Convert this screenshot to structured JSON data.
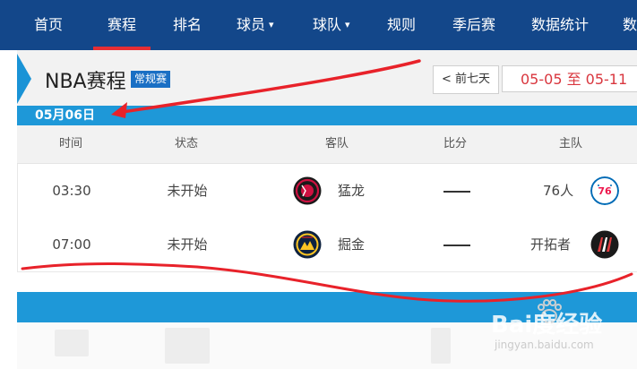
{
  "nav": {
    "items": [
      {
        "label": "首页"
      },
      {
        "label": "赛程"
      },
      {
        "label": "排名"
      },
      {
        "label": "球员",
        "chevron": "▾"
      },
      {
        "label": "球队",
        "chevron": "▾"
      },
      {
        "label": "规则"
      },
      {
        "label": "季后赛"
      },
      {
        "label": "数据统计"
      },
      {
        "label": "数"
      }
    ],
    "active": "赛程"
  },
  "header": {
    "title": "NBA赛程",
    "badge": "常规赛",
    "prev_button": "< 前七天",
    "date_range": "05-05 至 05-11"
  },
  "date_bar": {
    "date": "05月06日"
  },
  "table": {
    "columns": [
      "时间",
      "状态",
      "客队",
      "比分",
      "主队"
    ],
    "rows": [
      {
        "time": "03:30",
        "status": "未开始",
        "away": "猛龙",
        "away_logo": "raptors-logo-icon",
        "score": "",
        "home": "76人",
        "home_logo": "76ers-logo-icon"
      },
      {
        "time": "07:00",
        "status": "未开始",
        "away": "掘金",
        "away_logo": "nuggets-logo-icon",
        "score": "",
        "home": "开拓者",
        "home_logo": "trail-blazers-logo-icon"
      }
    ]
  },
  "colors": {
    "nav_bg": "#13478a",
    "accent_red": "#e62e34",
    "date_bar": "#1e98d8",
    "date_range_text": "#d9363e",
    "annotation": "#e8222a"
  },
  "watermark": {
    "main": "Bai度经验",
    "sub": "jingyan.baidu.com"
  }
}
